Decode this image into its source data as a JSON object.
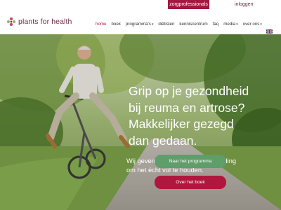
{
  "topbar": {
    "pro_label": "zorgprofessionals",
    "login_label": "inloggen"
  },
  "logo": {
    "text": "plants for health"
  },
  "menu": {
    "home": "home",
    "boek": "boek",
    "programmas": "programma's",
    "dietisten": "diëtisten",
    "kenniscentrum": "kenniscentrum",
    "faq": "faq",
    "media": "media",
    "over_ons": "over ons",
    "language_icon": "uk-flag-icon"
  },
  "hero": {
    "headline_lines": [
      "Grip op je gezondheid",
      "bij reuma en artrose?",
      "Makkelijker gezegd",
      "dan gedaan."
    ],
    "subtext_lines": [
      "Wij geven je de kennis en begeleiding",
      "om het écht vol te houden."
    ],
    "primary_cta": "Naar het programma",
    "secondary_cta": "Over het boek"
  },
  "colors": {
    "brand": "#a3183f",
    "menu_active": "#c4123e",
    "cta_green": "#5f9d6a",
    "cta_red": "#b0173f"
  }
}
